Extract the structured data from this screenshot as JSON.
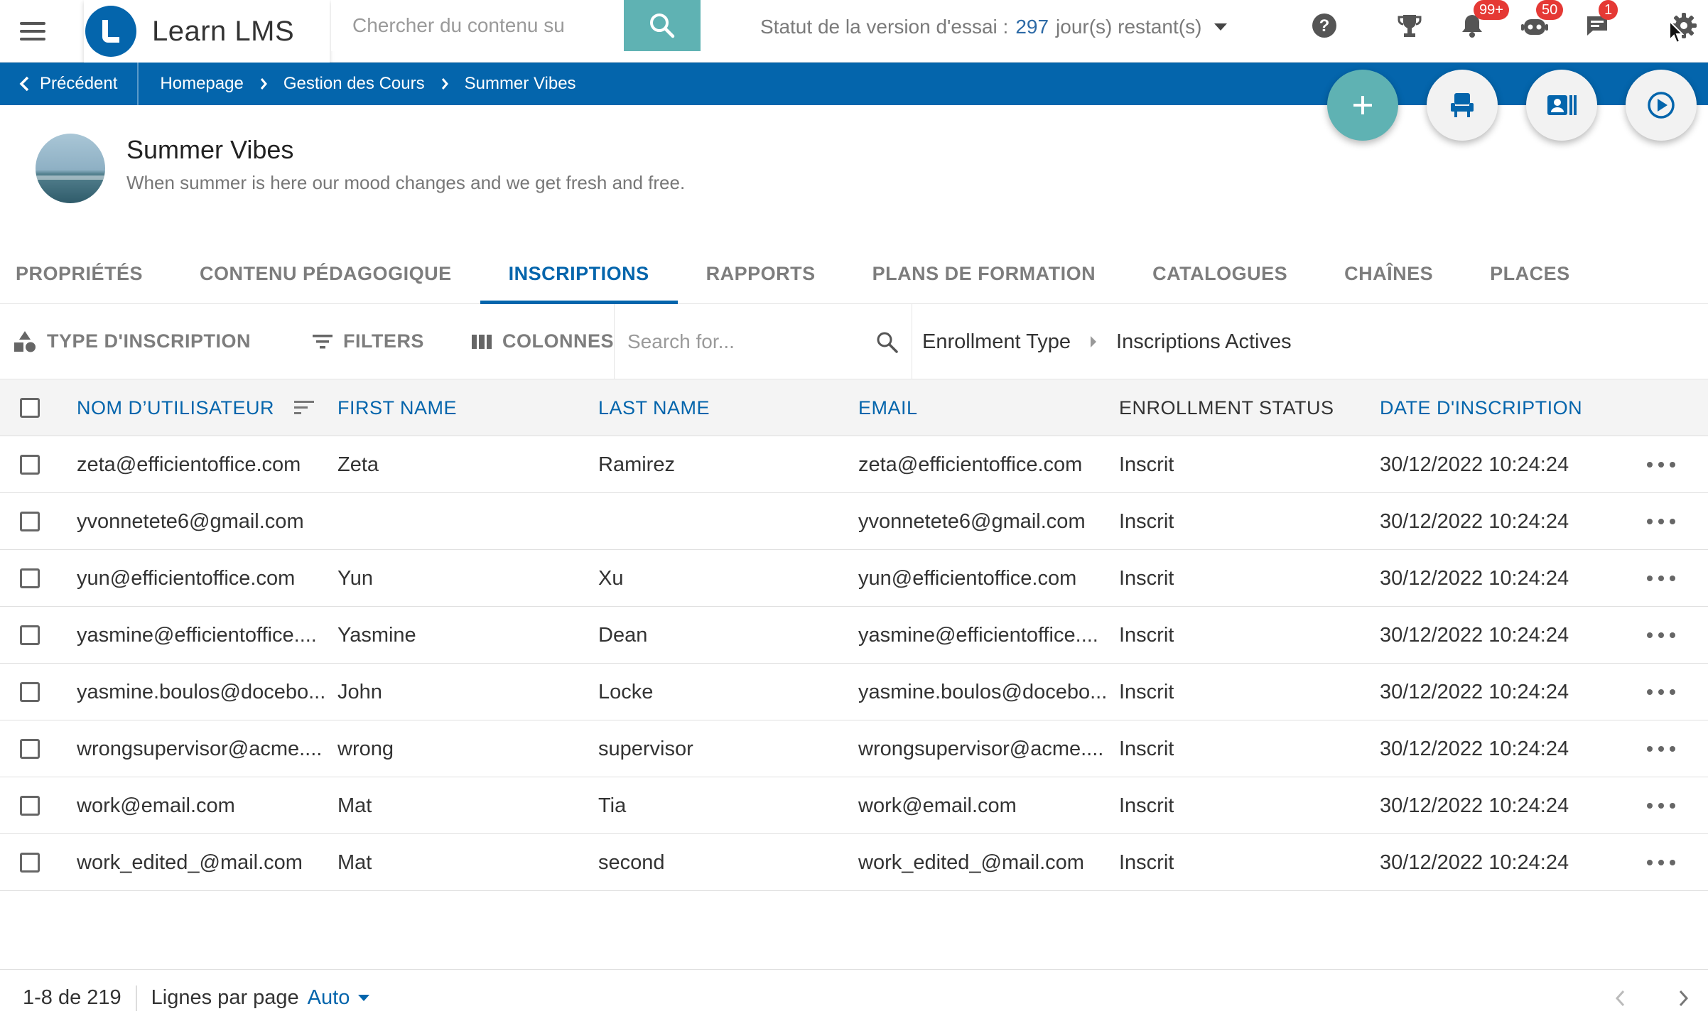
{
  "header": {
    "brand_name": "Learn LMS",
    "search_placeholder": "Chercher du contenu su",
    "trial_prefix": "Statut de la version d'essai :",
    "trial_days": "297",
    "trial_suffix": "jour(s) restant(s)",
    "badges": {
      "notifications": "99+",
      "robot": "50",
      "messages": "1"
    }
  },
  "breadcrumb": {
    "back_label": "Précédent",
    "items": [
      "Homepage",
      "Gestion des Cours",
      "Summer Vibes"
    ]
  },
  "course": {
    "title": "Summer Vibes",
    "description": "When summer is here our mood changes and we get fresh and free."
  },
  "tabs": [
    {
      "label": "PROPRIÉTÉS",
      "active": false
    },
    {
      "label": "CONTENU PÉDAGOGIQUE",
      "active": false
    },
    {
      "label": "INSCRIPTIONS",
      "active": true
    },
    {
      "label": "RAPPORTS",
      "active": false
    },
    {
      "label": "PLANS DE FORMATION",
      "active": false
    },
    {
      "label": "CATALOGUES",
      "active": false
    },
    {
      "label": "CHAÎNES",
      "active": false
    },
    {
      "label": "PLACES",
      "active": false
    }
  ],
  "toolbar": {
    "enrollment_type_label": "TYPE D'INSCRIPTION",
    "filters_label": "FILTERS",
    "columns_label": "COLONNES",
    "search_placeholder": "Search for...",
    "filter_crumbs": [
      "Enrollment Type",
      "Inscriptions Actives"
    ]
  },
  "table": {
    "columns": [
      "NOM D’UTILISATEUR",
      "FIRST NAME",
      "LAST NAME",
      "EMAIL",
      "ENROLLMENT STATUS",
      "DATE D'INSCRIPTION"
    ],
    "rows": [
      [
        "zeta@efficientoffice.com",
        "Zeta",
        "Ramirez",
        "zeta@efficientoffice.com",
        "Inscrit",
        "30/12/2022 10:24:24"
      ],
      [
        "yvonnetete6@gmail.com",
        "",
        "",
        "yvonnetete6@gmail.com",
        "Inscrit",
        "30/12/2022 10:24:24"
      ],
      [
        "yun@efficientoffice.com",
        "Yun",
        "Xu",
        "yun@efficientoffice.com",
        "Inscrit",
        "30/12/2022 10:24:24"
      ],
      [
        "yasmine@efficientoffice....",
        "Yasmine",
        "Dean",
        "yasmine@efficientoffice....",
        "Inscrit",
        "30/12/2022 10:24:24"
      ],
      [
        "yasmine.boulos@docebo...",
        "John",
        "Locke",
        "yasmine.boulos@docebo...",
        "Inscrit",
        "30/12/2022 10:24:24"
      ],
      [
        "wrongsupervisor@acme....",
        "wrong",
        "supervisor",
        "wrongsupervisor@acme....",
        "Inscrit",
        "30/12/2022 10:24:24"
      ],
      [
        "work@email.com",
        "Mat",
        "Tia",
        "work@email.com",
        "Inscrit",
        "30/12/2022 10:24:24"
      ],
      [
        "work_edited_@mail.com",
        "Mat",
        "second",
        "work_edited_@mail.com",
        "Inscrit",
        "30/12/2022 10:24:24"
      ]
    ]
  },
  "footer": {
    "range": "1-8 de 219",
    "rows_per_page_label": "Lignes par page",
    "rows_per_page_value": "Auto"
  },
  "colors": {
    "brand_blue": "#0465ac",
    "teal": "#5fb2b3",
    "badge_red": "#e53935"
  }
}
